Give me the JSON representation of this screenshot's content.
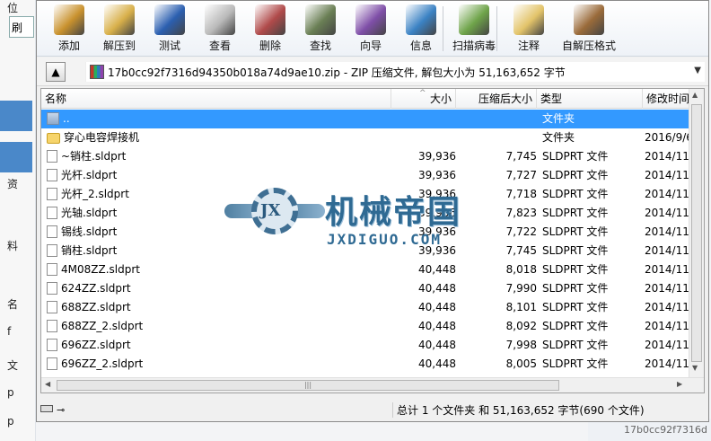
{
  "background": {
    "left_labels": [
      "位",
      "刷",
      "资",
      "料",
      "名",
      "f",
      "文",
      "p",
      "p"
    ],
    "bottom_text": "17b0cc92f7316d"
  },
  "toolbar": {
    "buttons": [
      {
        "label": "添加",
        "icon": "add-archive-icon",
        "color": "#c9922e"
      },
      {
        "label": "解压到",
        "icon": "extract-to-icon",
        "color": "#d8b04a"
      },
      {
        "label": "测试",
        "icon": "test-icon",
        "color": "#2b5fb0"
      },
      {
        "label": "查看",
        "icon": "view-icon",
        "color": "#b9b9b9"
      },
      {
        "label": "删除",
        "icon": "delete-icon",
        "color": "#b04a4a"
      },
      {
        "label": "查找",
        "icon": "find-icon",
        "color": "#6a7f55"
      },
      {
        "label": "向导",
        "icon": "wizard-icon",
        "color": "#7f4fa8"
      },
      {
        "label": "信息",
        "icon": "info-icon",
        "color": "#3b82c4"
      },
      {
        "label": "扫描病毒",
        "icon": "virus-scan-icon",
        "color": "#6fa44a"
      },
      {
        "label": "注释",
        "icon": "comment-icon",
        "color": "#e3c46a"
      },
      {
        "label": "自解压格式",
        "icon": "sfx-icon",
        "color": "#9a6b3a"
      }
    ]
  },
  "address": {
    "text": "17b0cc92f7316d94350b018a74d9ae10.zip - ZIP 压缩文件, 解包大小为 51,163,652 字节"
  },
  "columns": {
    "name": "名称",
    "size": "大小",
    "packed": "压缩后大小",
    "type": "类型",
    "modified": "修改时间"
  },
  "rows": [
    {
      "name": "..",
      "size": "",
      "packed": "",
      "type": "文件夹",
      "date": "",
      "icon": "up",
      "selected": true
    },
    {
      "name": "穿心电容焊接机",
      "size": "",
      "packed": "",
      "type": "文件夹",
      "date": "2016/9/6",
      "icon": "folder"
    },
    {
      "name": "~销柱.sldprt",
      "size": "39,936",
      "packed": "7,745",
      "type": "SLDPRT 文件",
      "date": "2014/11,",
      "icon": "file"
    },
    {
      "name": "光杆.sldprt",
      "size": "39,936",
      "packed": "7,727",
      "type": "SLDPRT 文件",
      "date": "2014/11,",
      "icon": "file"
    },
    {
      "name": "光杆_2.sldprt",
      "size": "39,936",
      "packed": "7,718",
      "type": "SLDPRT 文件",
      "date": "2014/11,",
      "icon": "file"
    },
    {
      "name": "光轴.sldprt",
      "size": "39,936",
      "packed": "7,823",
      "type": "SLDPRT 文件",
      "date": "2014/11,",
      "icon": "file"
    },
    {
      "name": "锡线.sldprt",
      "size": "39,936",
      "packed": "7,722",
      "type": "SLDPRT 文件",
      "date": "2014/11,",
      "icon": "file"
    },
    {
      "name": "销柱.sldprt",
      "size": "39,936",
      "packed": "7,745",
      "type": "SLDPRT 文件",
      "date": "2014/11,",
      "icon": "file"
    },
    {
      "name": "4M08ZZ.sldprt",
      "size": "40,448",
      "packed": "8,018",
      "type": "SLDPRT 文件",
      "date": "2014/11,",
      "icon": "file"
    },
    {
      "name": "624ZZ.sldprt",
      "size": "40,448",
      "packed": "7,990",
      "type": "SLDPRT 文件",
      "date": "2014/11,",
      "icon": "file"
    },
    {
      "name": "688ZZ.sldprt",
      "size": "40,448",
      "packed": "8,101",
      "type": "SLDPRT 文件",
      "date": "2014/11,",
      "icon": "file"
    },
    {
      "name": "688ZZ_2.sldprt",
      "size": "40,448",
      "packed": "8,092",
      "type": "SLDPRT 文件",
      "date": "2014/11,",
      "icon": "file"
    },
    {
      "name": "696ZZ.sldprt",
      "size": "40,448",
      "packed": "7,998",
      "type": "SLDPRT 文件",
      "date": "2014/11,",
      "icon": "file"
    },
    {
      "name": "696ZZ_2.sldprt",
      "size": "40,448",
      "packed": "8,005",
      "type": "SLDPRT 文件",
      "date": "2014/11,",
      "icon": "file"
    }
  ],
  "status": {
    "summary": "总计 1 个文件夹 和 51,163,652 字节(690 个文件)"
  },
  "watermark": {
    "logo_text": "JX",
    "title": "机械帝国",
    "subtitle": "JXDIGUO.COM"
  }
}
